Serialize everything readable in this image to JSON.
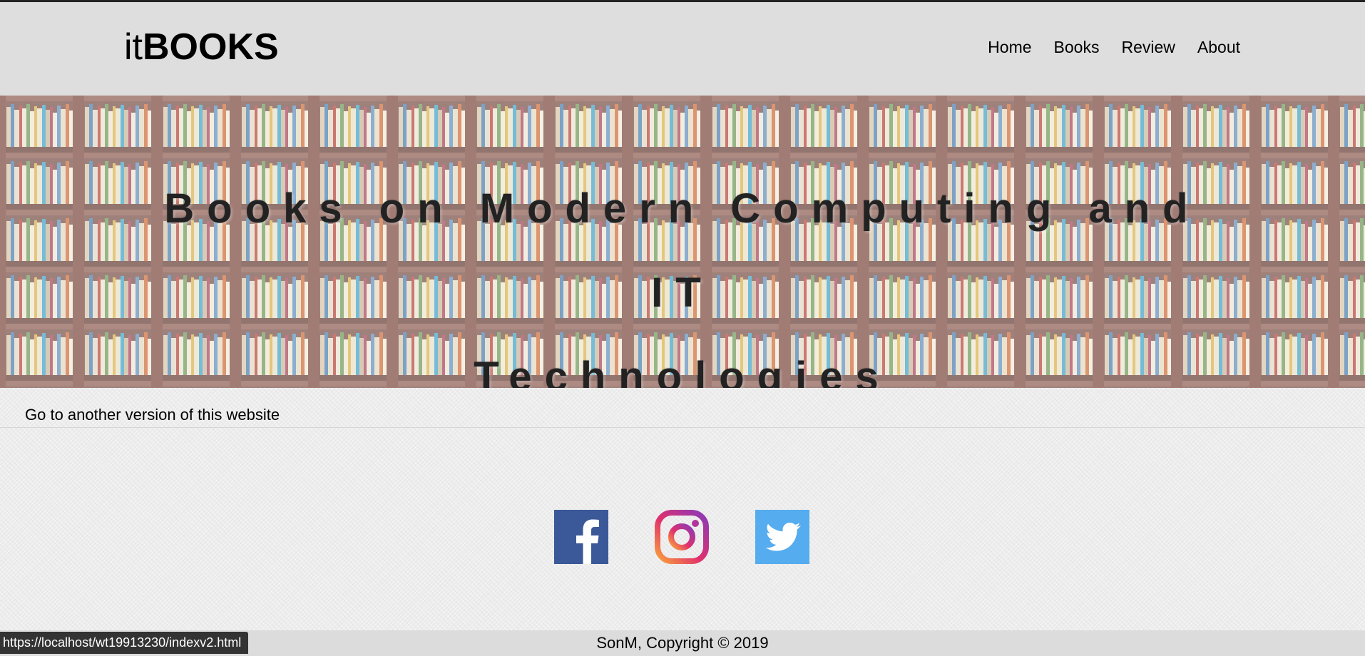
{
  "header": {
    "logo_light": "it",
    "logo_bold": "BOOKS",
    "nav": [
      "Home",
      "Books",
      "Review",
      "About"
    ]
  },
  "hero": {
    "line1": "Books on Modern Computing and IT",
    "line2": "Technologies"
  },
  "main": {
    "version_link": "Go to another version of this website"
  },
  "social": {
    "icons": [
      "facebook-icon",
      "instagram-icon",
      "twitter-icon"
    ],
    "colors": {
      "facebook": "#3b5998",
      "twitter": "#55acee"
    }
  },
  "footer": {
    "copyright": "SonM, Copyright © 2019"
  },
  "status_bar": {
    "url": "https://localhost/wt19913230/indexv2.html"
  }
}
